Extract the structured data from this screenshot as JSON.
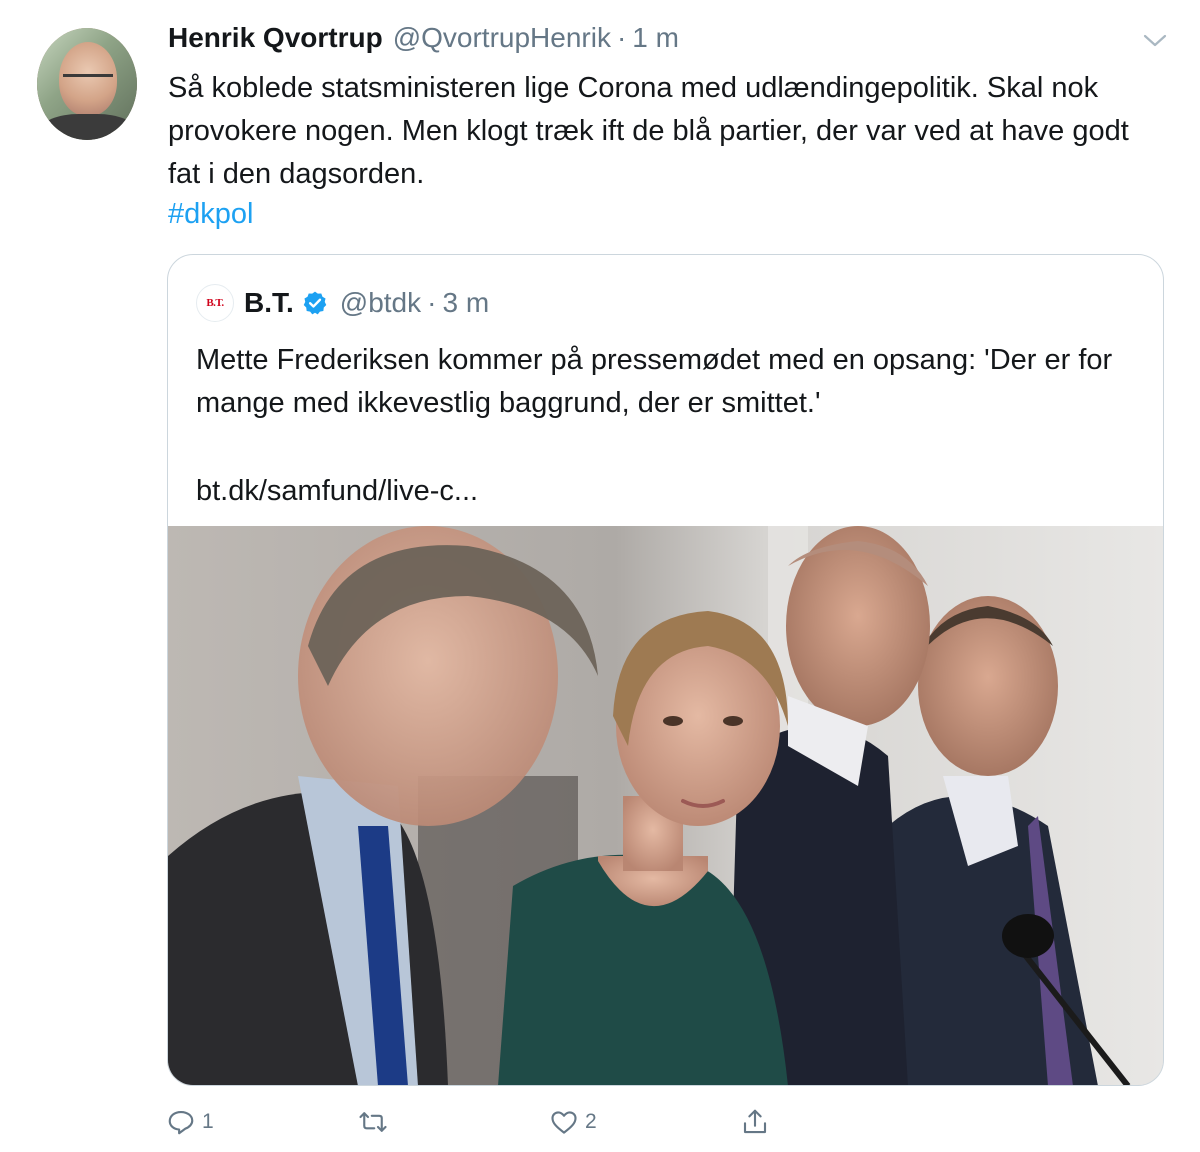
{
  "tweet": {
    "author_name": "Henrik Qvortrup",
    "author_handle": "@QvortrupHenrik",
    "separator": "·",
    "time": "1 m",
    "text": "Så koblede statsministeren lige Corona med udlændingepolitik. Skal nok provokere nogen. Men klogt træk ift de blå partier, der var ved at have godt fat i den dagsorden.",
    "hashtag": "#dkpol"
  },
  "quote": {
    "logo_text": "B.T.",
    "author_name": "B.T.",
    "author_handle": "@btdk",
    "separator": "·",
    "time": "3 m",
    "text": "Mette Frederiksen kommer på pressemødet med en opsang: 'Der er for mange med ikkevestlig baggrund, der er smittet.'",
    "link": "bt.dk/samfund/live-c..."
  },
  "actions": {
    "reply_count": "1",
    "retweet_count": "",
    "like_count": "2"
  },
  "colors": {
    "link": "#1da1f2",
    "secondary_text": "#657786",
    "border": "#ccd6dd",
    "verified": "#1da1f2",
    "bt_red": "#d0021b"
  },
  "icons": [
    "menu-chevron-icon",
    "verified-badge-icon",
    "reply-icon",
    "retweet-icon",
    "like-icon",
    "share-icon"
  ]
}
